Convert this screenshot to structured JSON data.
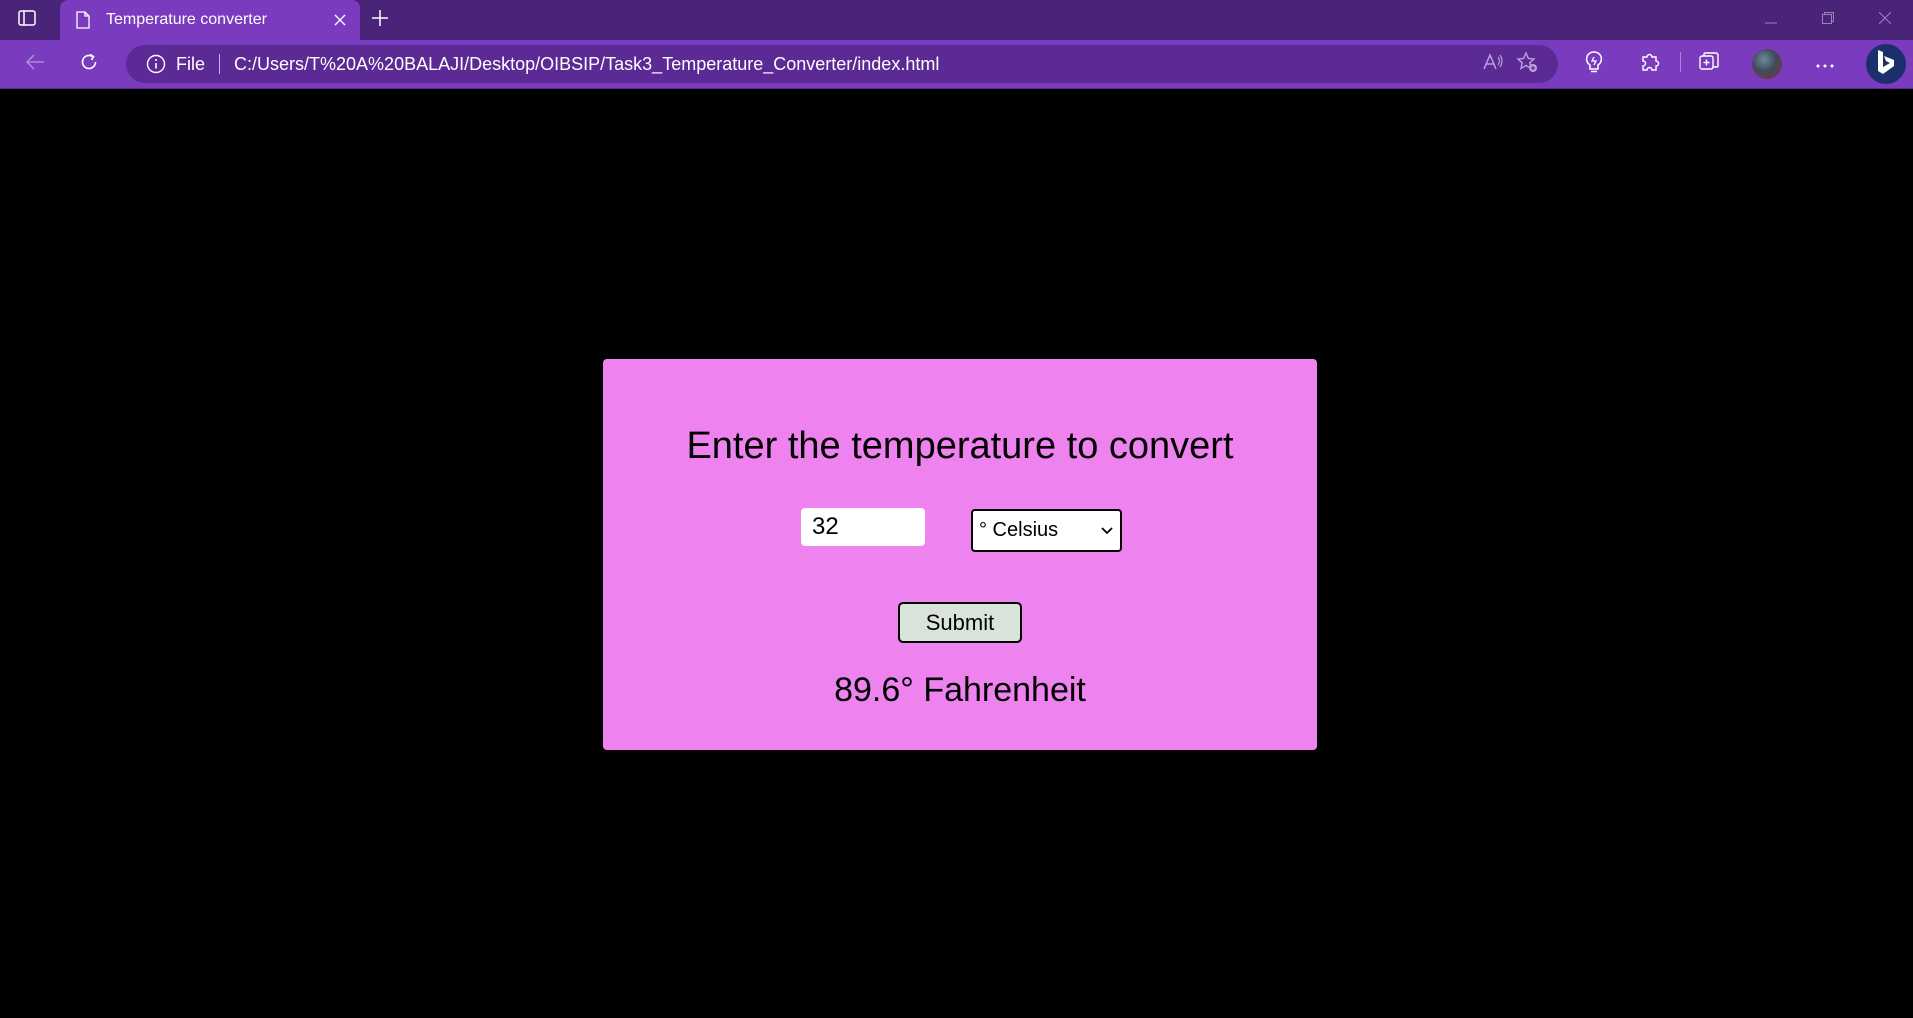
{
  "browser": {
    "tab": {
      "title": "Temperature converter",
      "icon": "page-icon"
    },
    "address_bar": {
      "scheme_label": "File",
      "url": "C:/Users/T%20A%20BALAJI/Desktop/OIBSIP/Task3_Temperature_Converter/index.html"
    },
    "icons": [
      "tab-actions-icon",
      "close-icon",
      "plus-icon",
      "minimize-icon",
      "restore-icon",
      "window-close-icon",
      "back-arrow-icon",
      "refresh-icon",
      "info-icon",
      "read-aloud-icon",
      "favorite-star-icon",
      "browser-essentials-icon",
      "extensions-icon",
      "collections-icon",
      "more-icon",
      "bing-icon"
    ],
    "colors": {
      "tabstrip": "#4a2478",
      "toolbar": "#7a3bbf",
      "omnibox": "#5b2a95"
    }
  },
  "page": {
    "heading": "Enter the temperature to convert",
    "input": {
      "value": "32"
    },
    "unit_select": {
      "selected": "° Celsius"
    },
    "submit_label": "Submit",
    "result": "89.6° Fahrenheit",
    "colors": {
      "background": "#000000",
      "card": "#ee82ee",
      "button": "#d9e3d9"
    }
  }
}
